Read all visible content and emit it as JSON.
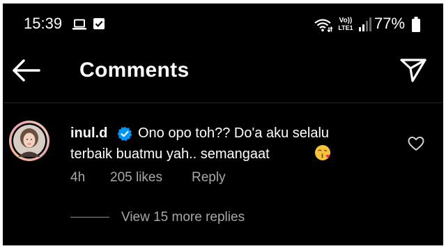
{
  "status_bar": {
    "time": "15:39",
    "volte_top": "Vo))",
    "volte_bottom": "LTE1",
    "battery": "77%"
  },
  "header": {
    "title": "Comments"
  },
  "comment": {
    "username": "inul.d",
    "text_line1": "Ono opo toh?? Do'a aku selalu",
    "text_line2": "terbaik buatmu yah.. semangaat",
    "time": "4h",
    "likes": "205 likes",
    "reply_label": "Reply",
    "view_replies": "View 15 more replies"
  },
  "colors": {
    "background": "#000000",
    "text": "#ffffff",
    "secondary_text": "#a8a8a8",
    "verified_badge": "#0095f6"
  },
  "icons": {
    "back": "arrow-left-icon",
    "share": "paper-plane-icon",
    "verified": "verified-badge-icon",
    "like": "heart-outline-icon",
    "emoji": "face-blowing-kiss-emoji"
  }
}
